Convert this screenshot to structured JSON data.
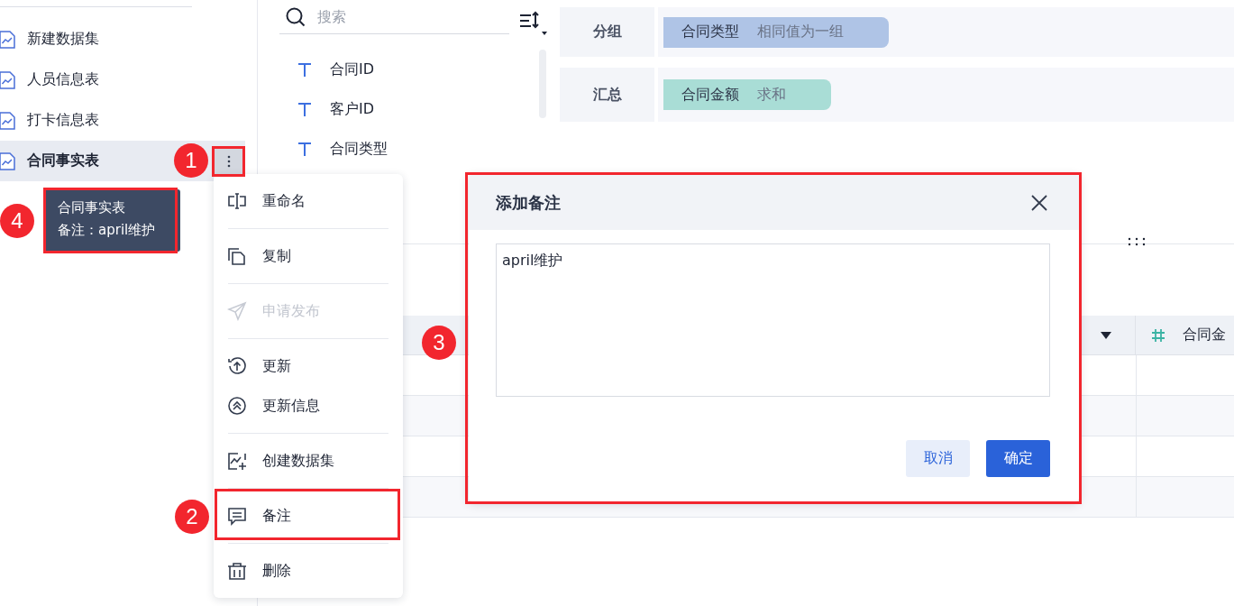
{
  "sidebar": {
    "items": [
      {
        "label": "新建数据集",
        "selected": false
      },
      {
        "label": "人员信息表",
        "selected": false
      },
      {
        "label": "打卡信息表",
        "selected": false
      },
      {
        "label": "合同事实表",
        "selected": true
      }
    ]
  },
  "fields": {
    "search": {
      "placeholder": "搜索"
    },
    "items": [
      {
        "label": "合同ID"
      },
      {
        "label": "客户ID"
      },
      {
        "label": "合同类型"
      }
    ]
  },
  "config": {
    "rows": [
      {
        "label": "分组",
        "chip": {
          "name": "合同类型",
          "note": "相同值为一组",
          "color": "#afc4e6"
        }
      },
      {
        "label": "汇总",
        "chip": {
          "name": "合同金额",
          "note": "求和",
          "color": "#a9ddd6"
        }
      }
    ]
  },
  "table": {
    "columns": [
      {
        "kind": "dropdown"
      },
      {
        "label": "合同金",
        "kind": "number"
      }
    ]
  },
  "context_menu": {
    "groups": [
      [
        {
          "label": "重命名",
          "disabled": false
        }
      ],
      [
        {
          "label": "复制",
          "disabled": false
        }
      ],
      [
        {
          "label": "申请发布",
          "disabled": true
        }
      ],
      [
        {
          "label": "更新",
          "disabled": false
        },
        {
          "label": "更新信息",
          "disabled": false
        }
      ],
      [
        {
          "label": "创建数据集",
          "disabled": false
        }
      ],
      [
        {
          "label": "备注",
          "disabled": false
        }
      ],
      [
        {
          "label": "删除",
          "disabled": false
        }
      ]
    ]
  },
  "tooltip": {
    "title": "合同事实表",
    "note": "备注：april维护"
  },
  "dialog": {
    "title": "添加备注",
    "value": "april维护",
    "buttons": [
      {
        "label": "取消",
        "kind": "secondary"
      },
      {
        "label": "确定",
        "kind": "primary"
      }
    ]
  },
  "callouts": [
    {
      "number": "1"
    },
    {
      "number": "2"
    },
    {
      "number": "3"
    },
    {
      "number": "4"
    }
  ]
}
